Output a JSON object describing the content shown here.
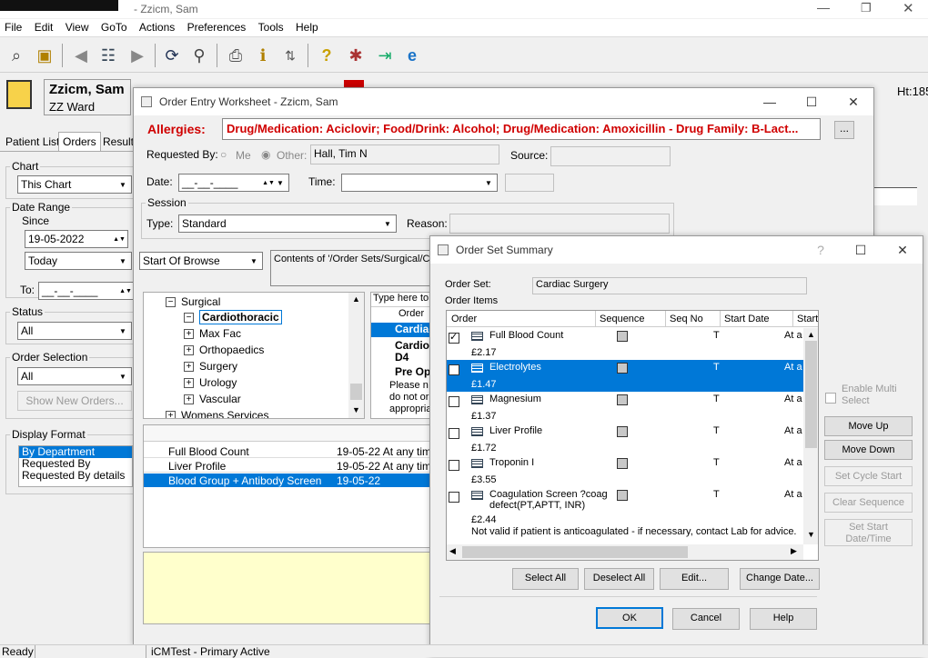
{
  "app": {
    "title": "- Zzicm, Sam",
    "menu": [
      "File",
      "Edit",
      "View",
      "GoTo",
      "Actions",
      "Preferences",
      "Tools",
      "Help"
    ]
  },
  "patient": {
    "name": "Zzicm, Sam",
    "ward": "ZZ Ward",
    "id_partial": "...",
    "ht_label": "Ht:185"
  },
  "left_panel": {
    "tabs": [
      "Patient List",
      "Orders",
      "Results"
    ],
    "chart_label": "Chart",
    "chart_value": "This Chart",
    "date_range_label": "Date Range",
    "since_label": "Since",
    "since_value": "19-05-2022",
    "today_value": "Today",
    "to_label": "To:",
    "to_value": "__-__-____",
    "status_label": "Status",
    "status_value": "All",
    "order_selection_label": "Order Selection",
    "order_selection_value": "All",
    "show_new_orders": "Show New Orders...",
    "display_format_label": "Display Format",
    "display_format_options": [
      "By Department",
      "Requested By",
      "Requested By details"
    ]
  },
  "order_entry": {
    "title": "Order Entry Worksheet - Zzicm, Sam",
    "allergies_label": "Allergies:",
    "allergies_text": "Drug/Medication: Aciclovir; Food/Drink: Alcohol; Drug/Medication: Amoxicillin - Drug Family: B-Lact...",
    "ellipsis_button": "...",
    "requested_by_label": "Requested By:",
    "me_label": "Me",
    "other_label": "Other:",
    "other_value": "Hall, Tim N",
    "source_label": "Source:",
    "date_label": "Date:",
    "date_value": "__-__-____",
    "time_label": "Time:",
    "session_label": "Session",
    "type_label": "Type:",
    "type_value": "Standard",
    "reason_label": "Reason:",
    "browse_value": "Start Of Browse",
    "contents_text": "Contents of '/Order Sets/Surgical/Ca",
    "tree": [
      {
        "label": "Surgical",
        "sign": "−"
      },
      {
        "label": "Cardiothoracic",
        "sign": "−"
      },
      {
        "label": "Max Fac",
        "sign": "+"
      },
      {
        "label": "Orthopaedics",
        "sign": "+"
      },
      {
        "label": "Surgery",
        "sign": "+"
      },
      {
        "label": "Urology",
        "sign": "+"
      },
      {
        "label": "Vascular",
        "sign": "+"
      },
      {
        "label": "Womens Services",
        "sign": "+"
      }
    ],
    "type_here": "Type here to",
    "order_col": "Order",
    "list_items": [
      "Cardiac",
      "Cardiot",
      "D4",
      "Pre Op"
    ],
    "please_note": [
      "Please n",
      "do not or",
      "appropria"
    ],
    "orders": [
      {
        "name": "Full Blood Count",
        "date": "19-05-22 At any time"
      },
      {
        "name": "Liver Profile",
        "date": "19-05-22 At any time"
      },
      {
        "name": "Blood Group + Antibody Screen",
        "date": "19-05-22"
      }
    ]
  },
  "order_set_summary": {
    "title": "Order Set Summary",
    "order_set_label": "Order Set:",
    "order_set_value": "Cardiac Surgery",
    "order_items_label": "Order Items",
    "columns": [
      "Order",
      "Sequence",
      "Seq No",
      "Start Date",
      "Start"
    ],
    "items": [
      {
        "name": "Full Blood Count",
        "price": "£2.17",
        "checked": true,
        "start": "T",
        "at": "At a"
      },
      {
        "name": "Electrolytes",
        "price": "£1.47",
        "checked": true,
        "start": "T",
        "at": "At a"
      },
      {
        "name": "Magnesium",
        "price": "£1.37",
        "checked": false,
        "start": "T",
        "at": "At a"
      },
      {
        "name": "Liver Profile",
        "price": "£1.72",
        "checked": false,
        "start": "T",
        "at": "At a"
      },
      {
        "name": "Troponin I",
        "price": "£3.55",
        "checked": false,
        "start": "T",
        "at": "At a"
      },
      {
        "name": "Coagulation Screen ?coag",
        "name2": "defect(PT,APTT, INR)",
        "price": "£2.44",
        "note": "Not valid if patient is anticoagulated - if necessary, contact Lab for advice.",
        "checked": false,
        "start": "T",
        "at": "At a"
      }
    ],
    "enable_multi_select": "Enable Multi Select",
    "move_up": "Move Up",
    "move_down": "Move Down",
    "set_cycle_start": "Set Cycle Start",
    "clear_sequence": "Clear Sequence",
    "set_start_datetime": "Set Start Date/Time",
    "select_all": "Select All",
    "deselect_all": "Deselect All",
    "edit": "Edit...",
    "change_date": "Change Date...",
    "ok": "OK",
    "cancel": "Cancel",
    "help": "Help"
  },
  "status_bar": {
    "ready": "Ready",
    "env": "iCMTest - Primary Active"
  }
}
